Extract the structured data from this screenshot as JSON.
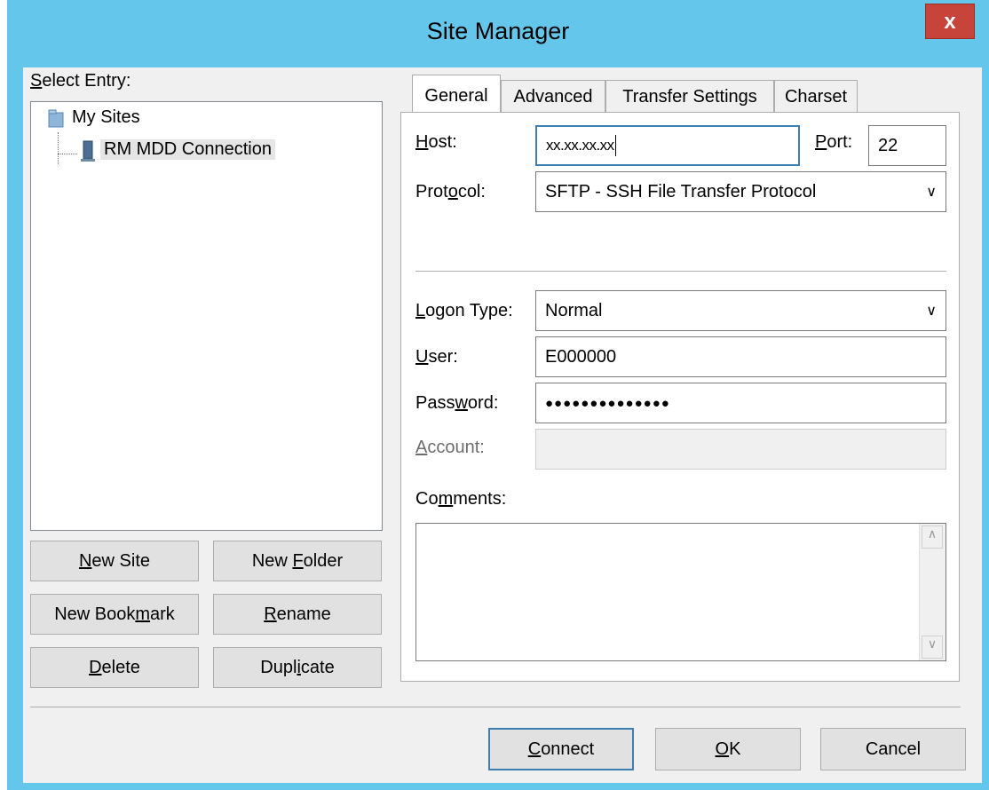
{
  "window": {
    "title": "Site Manager",
    "close_label": "x"
  },
  "left": {
    "select_entry_label": "Select Entry:",
    "tree": {
      "root": "My Sites",
      "child": "RM MDD Connection"
    },
    "buttons": {
      "new_site": "New Site",
      "new_folder": "New Folder",
      "new_bookmark": "New Bookmark",
      "rename": "Rename",
      "delete": "Delete",
      "duplicate": "Duplicate"
    }
  },
  "tabs": [
    "General",
    "Advanced",
    "Transfer Settings",
    "Charset"
  ],
  "general": {
    "host_label": "Host:",
    "host_value": "xx.xx.xx.xx",
    "port_label": "Port:",
    "port_value": "22",
    "protocol_label": "Protocol:",
    "protocol_value": "SFTP - SSH File Transfer Protocol",
    "logon_type_label": "Logon Type:",
    "logon_type_value": "Normal",
    "user_label": "User:",
    "user_value": "E000000",
    "password_label": "Password:",
    "password_value": "●●●●●●●●●●●●●●",
    "account_label": "Account:",
    "comments_label": "Comments:"
  },
  "footer": {
    "connect": "Connect",
    "ok": "OK",
    "cancel": "Cancel"
  },
  "colors": {
    "titlebar": "#63c6ea",
    "close_button": "#c7443b",
    "focus_border": "#3c7fb1"
  }
}
